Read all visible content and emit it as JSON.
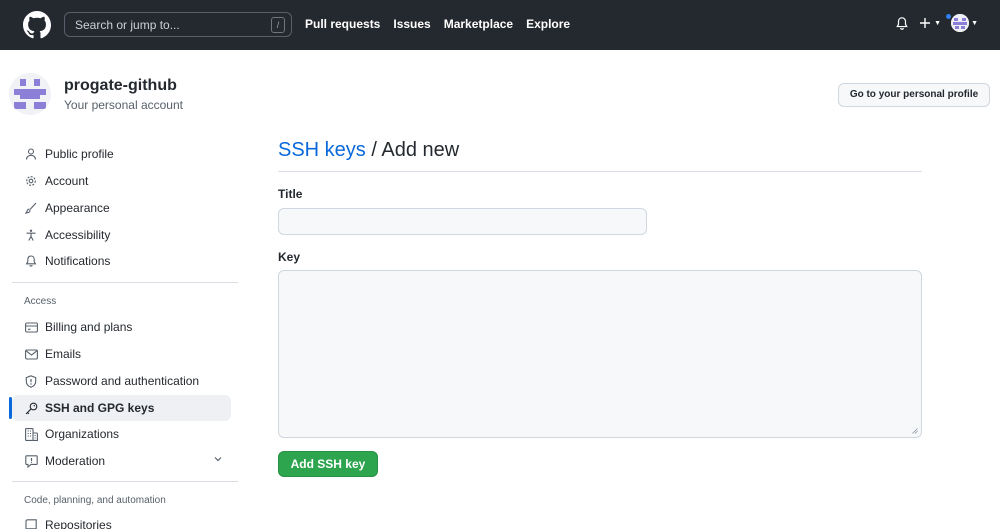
{
  "header": {
    "search_placeholder": "Search or jump to...",
    "search_shortcut": "/",
    "nav": [
      "Pull requests",
      "Issues",
      "Marketplace",
      "Explore"
    ],
    "icons": [
      "github-logo",
      "bell-icon",
      "plus-icon",
      "avatar"
    ]
  },
  "account": {
    "name": "progate-github",
    "subtitle": "Your personal account",
    "profile_button": "Go to your personal profile"
  },
  "sidebar": {
    "items": [
      {
        "label": "Public profile",
        "icon": "person-icon"
      },
      {
        "label": "Account",
        "icon": "gear-icon"
      },
      {
        "label": "Appearance",
        "icon": "paintbrush-icon"
      },
      {
        "label": "Accessibility",
        "icon": "accessibility-icon"
      },
      {
        "label": "Notifications",
        "icon": "bell-icon"
      }
    ],
    "access_heading": "Access",
    "access_items": [
      {
        "label": "Billing and plans",
        "icon": "credit-card-icon"
      },
      {
        "label": "Emails",
        "icon": "mail-icon"
      },
      {
        "label": "Password and authentication",
        "icon": "shield-icon"
      },
      {
        "label": "SSH and GPG keys",
        "icon": "key-icon"
      },
      {
        "label": "Organizations",
        "icon": "organization-icon"
      },
      {
        "label": "Moderation",
        "icon": "report-icon"
      }
    ],
    "code_heading": "Code, planning, and automation",
    "code_items": [
      {
        "label": "Repositories",
        "icon": "repo-icon"
      }
    ]
  },
  "main": {
    "breadcrumb_link": "SSH keys",
    "breadcrumb_separator": " / ",
    "page_title": "Add new",
    "title_label": "Title",
    "title_value": "",
    "key_label": "Key",
    "key_value": "",
    "submit_label": "Add SSH key"
  },
  "colors": {
    "header_bg": "#24292f",
    "link": "#0969da",
    "primary_button": "#2da44e",
    "active_indicator": "#0969da"
  }
}
